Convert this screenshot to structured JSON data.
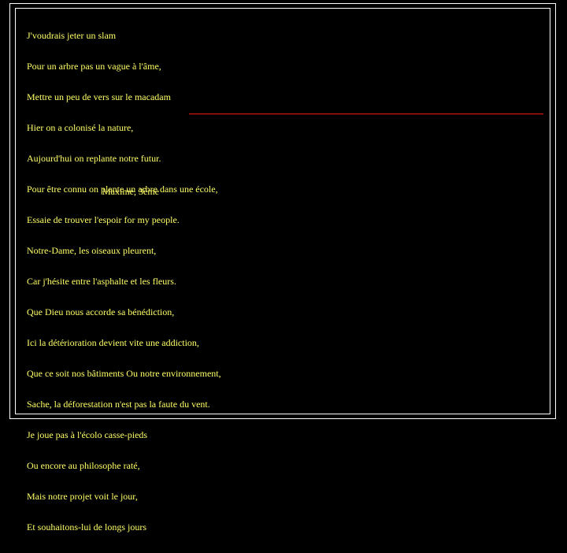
{
  "poem": {
    "lines": [
      "J'voudrais jeter un slam",
      "Pour un arbre pas un vague à l'âme,",
      "Mettre un peu de vers sur le macadam",
      "Hier on a colonisé la nature,",
      "Aujourd'hui on replante notre futur.",
      "Pour être connu on plante un arbre dans une école,",
      "Essaie de trouver l'espoir for my people.",
      "Notre-Dame, les oiseaux pleurent,",
      "Car j'hésite entre l'asphalte et les fleurs.",
      "Que Dieu nous accorde sa bénédiction,",
      "Ici la détérioration devient vite une addiction,",
      "Que ce soit nos bâtiments Ou notre environnement,",
      "Sache, la déforestation n'est pas la faute du vent.",
      "Je joue pas à l'écolo casse-pieds",
      "Ou encore au philosophe raté,",
      "Mais notre projet voit le jour,",
      "Et souhaitons-lui de longs jours"
    ],
    "byline": "Maxime, 3ème"
  },
  "style": {
    "text_color": "#ffff66",
    "rule_color": "#d01717"
  }
}
